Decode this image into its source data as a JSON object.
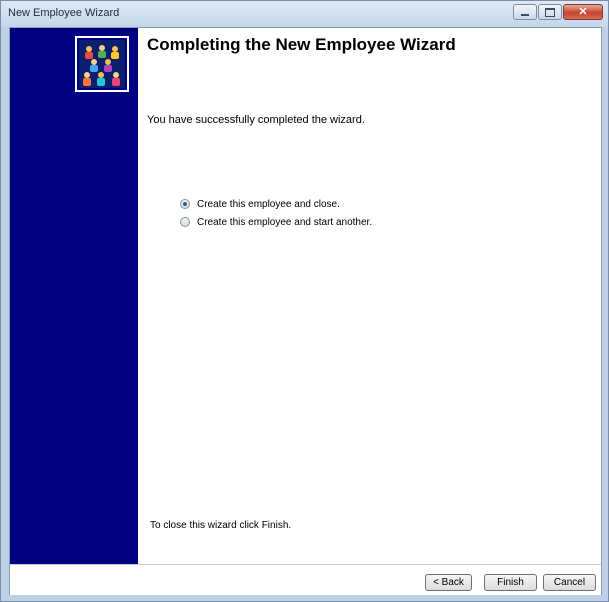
{
  "window": {
    "title": "New Employee Wizard",
    "controls": [
      "minimize",
      "maximize",
      "close"
    ]
  },
  "sidebar": {
    "background": "#000080",
    "logo_icon": "people-group-icon"
  },
  "content": {
    "heading": "Completing the New Employee Wizard",
    "intro": "You have successfully completed the wizard.",
    "options": [
      {
        "label": "Create this employee and close.",
        "checked": true
      },
      {
        "label": "Create this employee and start another.",
        "checked": false
      }
    ],
    "closing_text": "To close this wizard click Finish."
  },
  "footer": {
    "back_label": "< Back",
    "finish_label": "Finish",
    "cancel_label": "Cancel"
  }
}
